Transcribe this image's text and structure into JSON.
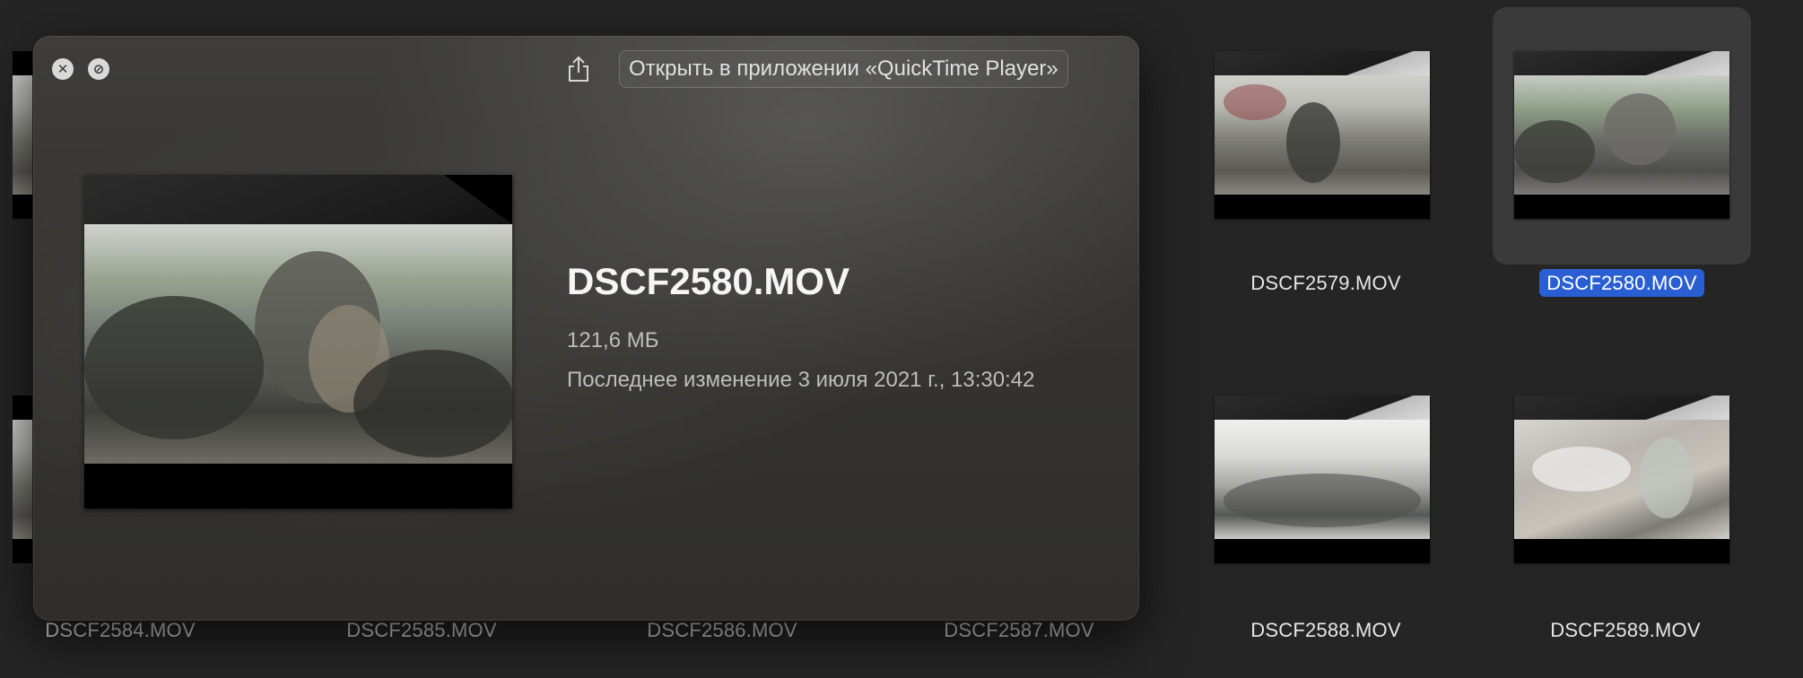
{
  "quicklook": {
    "close_icon": "close-icon",
    "fullscreen_icon": "fullscreen-icon",
    "share_icon": "share-icon",
    "open_button": "Открыть в приложении «QuickTime Player»",
    "filename": "DSCF2580.MOV",
    "size": "121,6 МБ",
    "modified": "Последнее изменение 3 июля 2021 г., 13:30:42"
  },
  "files": {
    "top": [
      {
        "name": "DSCF2579.MOV"
      },
      {
        "name": "DSCF2580.MOV",
        "selected": true
      }
    ],
    "bottom": [
      {
        "name": "DSCF2584.MOV"
      },
      {
        "name": "DSCF2585.MOV"
      },
      {
        "name": "DSCF2586.MOV"
      },
      {
        "name": "DSCF2587.MOV"
      },
      {
        "name": "DSCF2588.MOV"
      },
      {
        "name": "DSCF2589.MOV"
      }
    ]
  },
  "colors": {
    "selection": "#2a5fd3",
    "background": "#252525"
  }
}
